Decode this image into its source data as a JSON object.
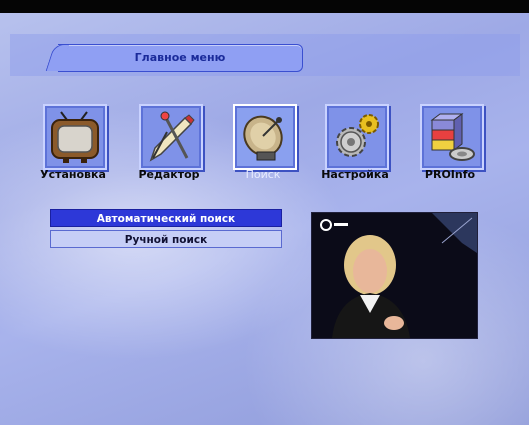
{
  "header": {
    "title": "Главное меню"
  },
  "menu": {
    "items": [
      {
        "label": "Установка",
        "icon": "tv-icon"
      },
      {
        "label": "Редактор",
        "icon": "edit-tools-icon"
      },
      {
        "label": "Поиск",
        "icon": "satellite-dish-icon",
        "active": true
      },
      {
        "label": "Настройка",
        "icon": "gears-icon"
      },
      {
        "label": "PROInfo",
        "icon": "database-icon"
      }
    ]
  },
  "search_submenu": {
    "options": [
      {
        "label": "Автоматический поиск",
        "selected": true
      },
      {
        "label": "Ручной поиск",
        "selected": false
      }
    ]
  },
  "colors": {
    "accent_selected": "#2d38d8",
    "menu_text": "#0a0a0a"
  }
}
